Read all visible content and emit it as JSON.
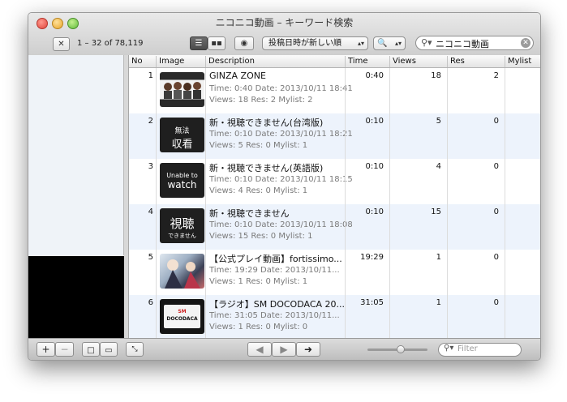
{
  "window": {
    "title": "ニコニコ動画 – キーワード検索"
  },
  "toolbar": {
    "count_text": "1 – 32 of 78,119",
    "sort_selected": "投稿日時が新しい順",
    "search_value": "ニコニコ動画"
  },
  "table": {
    "columns": [
      "No",
      "Image",
      "Description",
      "Time",
      "Views",
      "Res",
      "Mylist"
    ],
    "rows": [
      {
        "no": "1",
        "title": "GINZA ZONE",
        "line1": "Time: 0:40  Date: 2013/10/11 18:41",
        "line2": "Views: 18  Res: 2  Mylist: 2",
        "time": "0:40",
        "views": "18",
        "res": "2"
      },
      {
        "no": "2",
        "title": "新・視聴できません(台湾版)",
        "line1": "Time: 0:10  Date: 2013/10/11 18:21",
        "line2": "Views: 5  Res: 0  Mylist: 1",
        "time": "0:10",
        "views": "5",
        "res": "0",
        "thumb": [
          "無法",
          "収看"
        ]
      },
      {
        "no": "3",
        "title": "新・視聴できません(英語版)",
        "line1": "Time: 0:10  Date: 2013/10/11 18:15",
        "line2": "Views: 4  Res: 0  Mylist: 1",
        "time": "0:10",
        "views": "4",
        "res": "0",
        "thumb": [
          "Unable to",
          "watch"
        ]
      },
      {
        "no": "4",
        "title": "新・視聴できません",
        "line1": "Time: 0:10  Date: 2013/10/11 18:08",
        "line2": "Views: 15  Res: 0  Mylist: 1",
        "time": "0:10",
        "views": "15",
        "res": "0",
        "thumb": [
          "視聴",
          "できません"
        ]
      },
      {
        "no": "5",
        "title": "【公式プレイ動画】fortissimo...",
        "line1": "Time: 19:29  Date: 2013/10/11...",
        "line2": "Views: 1  Res: 0  Mylist: 1",
        "time": "19:29",
        "views": "1",
        "res": "0"
      },
      {
        "no": "6",
        "title": "【ラジオ】SM DOCODACA 20...",
        "line1": "Time: 31:05  Date: 2013/10/11...",
        "line2": "Views: 1  Res: 0  Mylist: 0",
        "time": "31:05",
        "views": "1",
        "res": "0",
        "thumb": [
          "SM",
          "DOCODACA"
        ]
      }
    ]
  },
  "bottom": {
    "filter_placeholder": "Filter"
  },
  "colors": {
    "row_alt": "#edf3fc",
    "sidebar": "#eff3f8"
  }
}
